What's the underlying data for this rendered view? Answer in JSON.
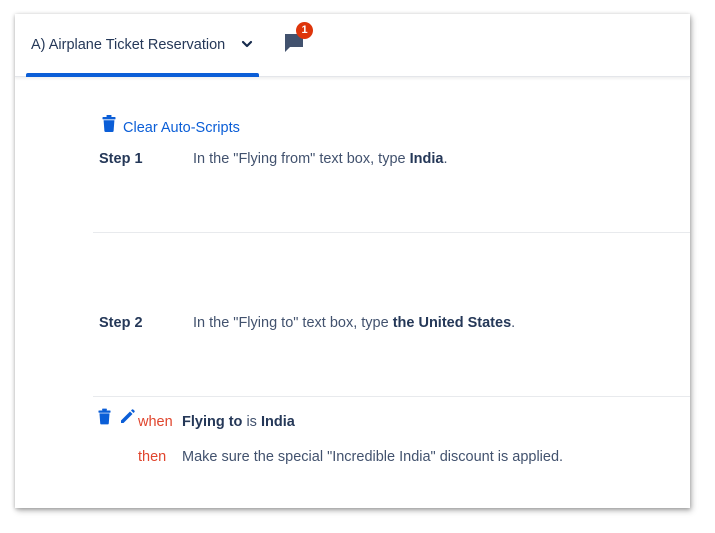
{
  "header": {
    "tab_label": "A) Airplane Ticket Reservation",
    "comment_badge_count": "1",
    "icons": {
      "tab_dropdown": "chevron-down-icon",
      "comments": "comment-icon"
    }
  },
  "toolbar": {
    "clear_label": "Clear Auto-Scripts",
    "clear_icon": "trash-icon"
  },
  "steps": [
    {
      "label": "Step 1",
      "text_before": "In the \"Flying from\" text box, type ",
      "text_bold": "India",
      "text_after": "."
    },
    {
      "label": "Step 2",
      "text_before": "In the \"Flying to\" text box, type ",
      "text_bold": "the United States",
      "text_after": "."
    }
  ],
  "rule": {
    "icons": {
      "delete": "trash-icon",
      "edit": "pencil-icon"
    },
    "when_keyword": "when",
    "when_field": "Flying to",
    "when_operator": "is",
    "when_value": "India",
    "then_keyword": "then",
    "then_text": "Make sure the special \"Incredible India\" discount is applied."
  },
  "colors": {
    "accent": "#0b5ed7",
    "keyword": "#e0452d",
    "badge": "#de350b",
    "text_dark": "#253858",
    "text_body": "#42526e"
  }
}
